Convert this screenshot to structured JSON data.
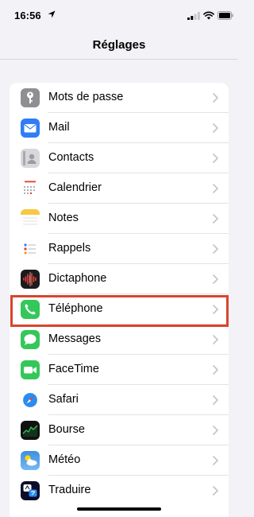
{
  "status_bar": {
    "time": "16:56"
  },
  "nav": {
    "title": "Réglages"
  },
  "settings_items": [
    {
      "label": "Mots de passe",
      "icon": "key-icon",
      "color": "#8e8e93"
    },
    {
      "label": "Mail",
      "icon": "mail-icon",
      "color": "#2f7cf6"
    },
    {
      "label": "Contacts",
      "icon": "contacts-icon",
      "color": "#a9a9ae"
    },
    {
      "label": "Calendrier",
      "icon": "calendar-icon",
      "color": "#ffffff"
    },
    {
      "label": "Notes",
      "icon": "notes-icon",
      "color": "#ffffff"
    },
    {
      "label": "Rappels",
      "icon": "reminders-icon",
      "color": "#ffffff"
    },
    {
      "label": "Dictaphone",
      "icon": "voice-memos-icon",
      "color": "#1c1c1e"
    },
    {
      "label": "Téléphone",
      "icon": "phone-icon",
      "color": "#34c759",
      "highlighted": true
    },
    {
      "label": "Messages",
      "icon": "messages-icon",
      "color": "#34c759"
    },
    {
      "label": "FaceTime",
      "icon": "facetime-icon",
      "color": "#34c759"
    },
    {
      "label": "Safari",
      "icon": "safari-icon",
      "color": "#2a8cf0"
    },
    {
      "label": "Bourse",
      "icon": "stocks-icon",
      "color": "#111111"
    },
    {
      "label": "Météo",
      "icon": "weather-icon",
      "color": "#3b8fe0"
    },
    {
      "label": "Traduire",
      "icon": "translate-icon",
      "color": "#0b0b2a"
    }
  ],
  "highlight_color": "#d9442e"
}
